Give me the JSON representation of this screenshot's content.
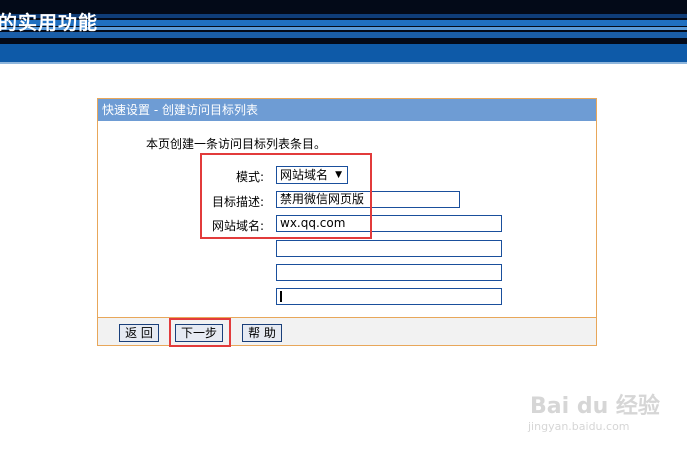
{
  "banner": {
    "title": "的实用功能"
  },
  "panel": {
    "header": "快速设置 - 创建访问目标列表",
    "intro": "本页创建一条访问目标列表条目。",
    "mode_label": "模式:",
    "mode_value": "网站域名",
    "desc_label": "目标描述:",
    "desc_value": "禁用微信网页版",
    "domain_label": "网站域名:",
    "domains": [
      "wx.qq.com",
      "",
      "",
      ""
    ]
  },
  "buttons": {
    "back": "返 回",
    "next": "下一步",
    "help": "帮 助"
  },
  "watermark": {
    "brand": "Bai du 经验",
    "url": "jingyan.baidu.com"
  },
  "colors": {
    "highlight": "#e23b3b",
    "header": "#6e9cd4",
    "banner": "#0e5aa8"
  }
}
